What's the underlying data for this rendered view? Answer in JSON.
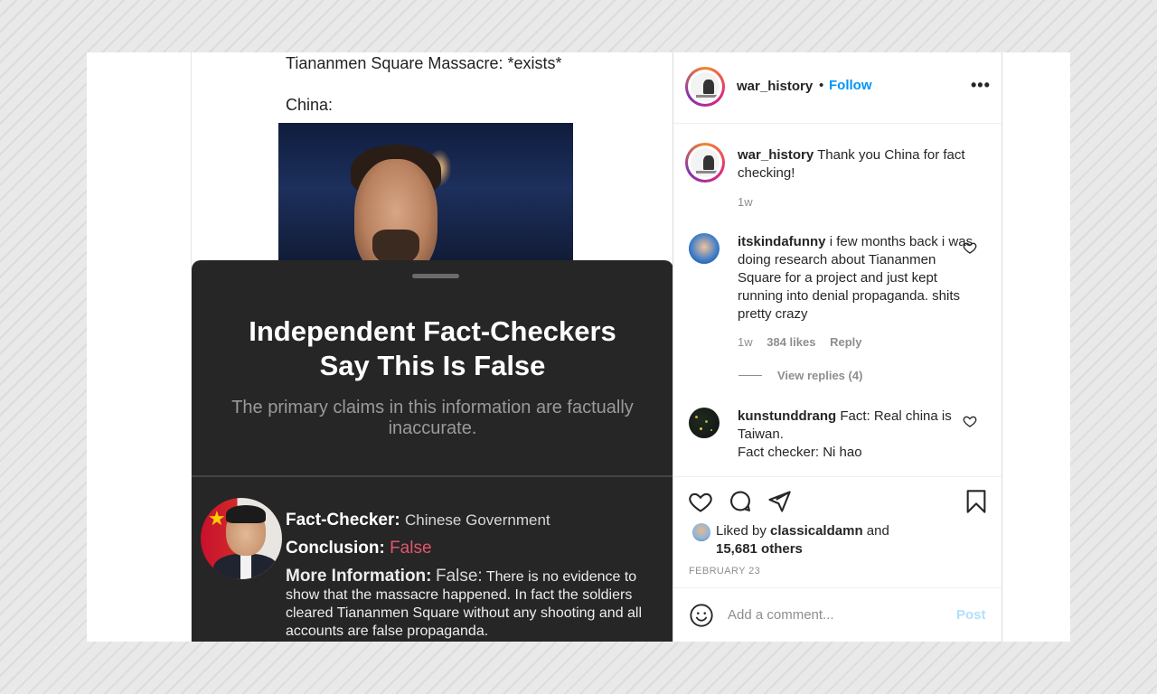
{
  "post_image": {
    "meme_line1": "Tiananmen Square Massacre: *exists*",
    "meme_line2": "China:",
    "sheet": {
      "title_line1": "Independent Fact-Checkers",
      "title_line2": "Say This Is False",
      "subtitle": "The primary claims in this information are factually inaccurate.",
      "fact_checker_label": "Fact-Checker:",
      "fact_checker_value": "Chinese Government",
      "conclusion_label": "Conclusion:",
      "conclusion_value": "False",
      "more_info_label": "More Information:",
      "more_info_verdict": "False:",
      "more_info_text": "There is no evidence to show that the massacre happened. In fact the soldiers cleared Tiananmen Square without any shooting and all accounts are false propaganda."
    }
  },
  "header": {
    "username": "war_history",
    "dot": "•",
    "follow_label": "Follow",
    "more_label": "•••"
  },
  "caption": {
    "username": "war_history",
    "text": "Thank you China for fact checking!",
    "time": "1w"
  },
  "comments": [
    {
      "username": "itskindafunny",
      "text": "i few months back i was doing research about Tiananmen Square for a project and just kept running into denial propaganda. shits pretty crazy",
      "time": "1w",
      "likes": "384 likes",
      "reply_label": "Reply",
      "view_replies": "View replies (4)"
    },
    {
      "username": "kunstunddrang",
      "text_line1": "Fact: Real china is Taiwan.",
      "text_line2": "Fact checker: Ni hao"
    }
  ],
  "likes": {
    "prefix": "Liked by",
    "user": "classicaldamn",
    "and": "and",
    "others": "15,681 others"
  },
  "date": "FEBRUARY 23",
  "comment_box": {
    "placeholder": "Add a comment...",
    "post_label": "Post"
  },
  "colors": {
    "follow_blue": "#0095f6",
    "post_disabled": "#b2dffc",
    "false_red": "#e0566b",
    "sheet_bg": "#262626"
  },
  "icons": [
    "heart-icon",
    "comment-icon",
    "share-icon",
    "bookmark-icon",
    "smile-icon",
    "more-icon"
  ]
}
